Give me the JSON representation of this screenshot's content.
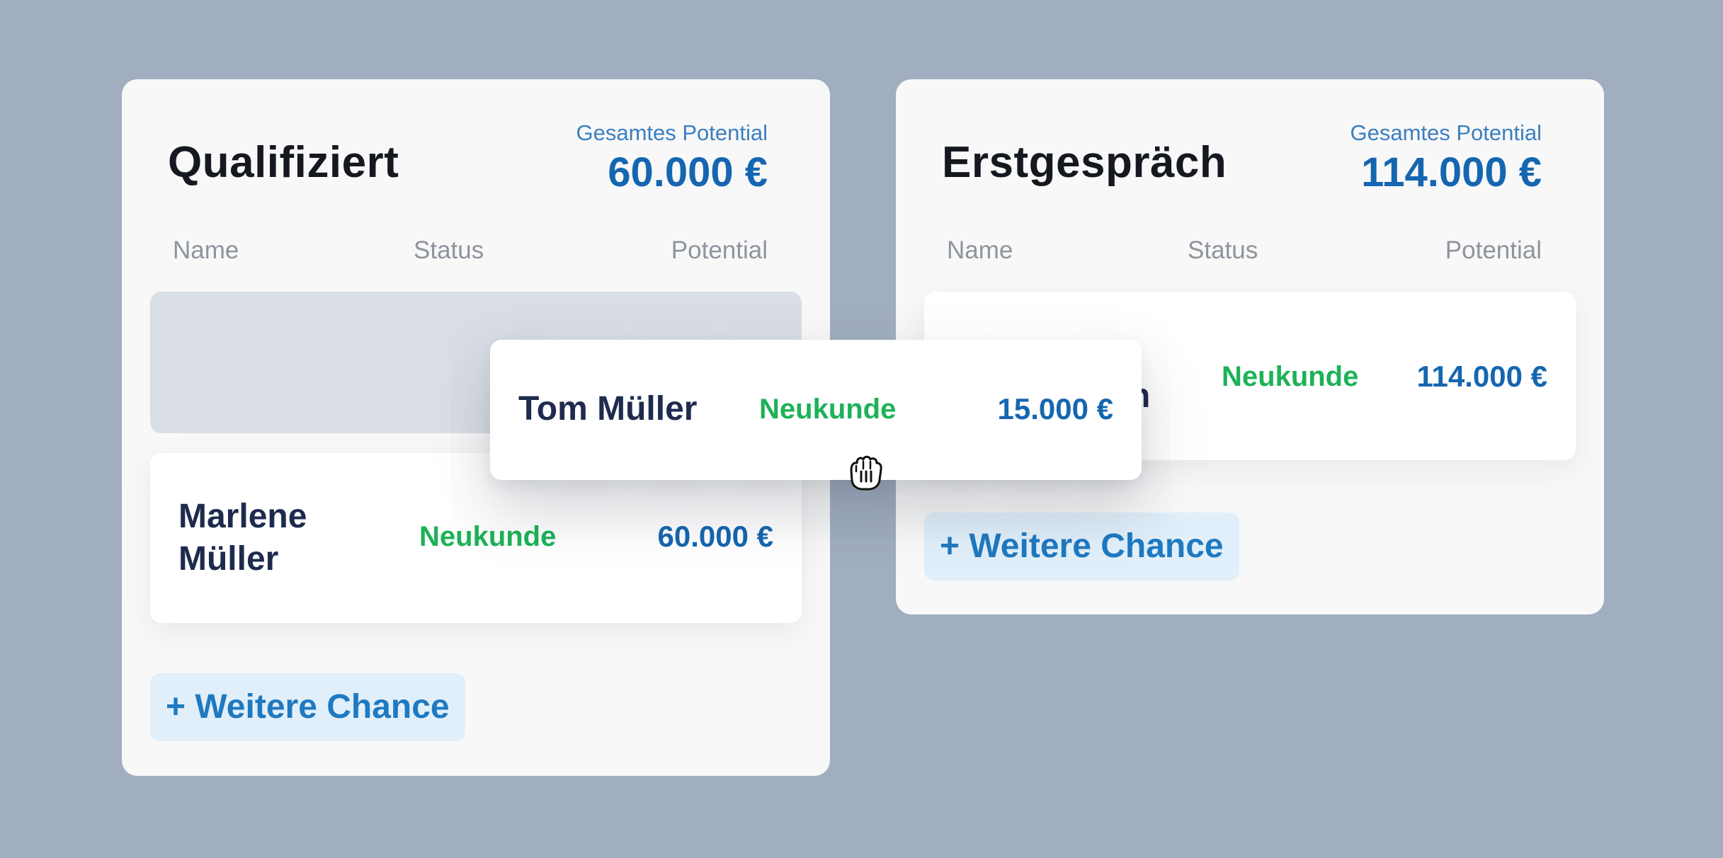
{
  "colors": {
    "background": "#a1aec0",
    "panel": "#f8f8f8",
    "placeholder": "#d9dee5",
    "accent_blue": "#1566b0",
    "status_green": "#1db257",
    "button_bg": "#e0effa"
  },
  "columns": [
    {
      "title": "Qualifiziert",
      "potential_label": "Gesamtes Potential",
      "potential_value": "60.000 €",
      "headers": {
        "name": "Name",
        "status": "Status",
        "potential": "Potential"
      },
      "cards": [
        {
          "name": "Marlene Müller",
          "status": "Neukunde",
          "potential": "60.000 €"
        }
      ],
      "add_button": "+ Weitere Chance"
    },
    {
      "title": "Erstgespräch",
      "potential_label": "Gesamtes Potential",
      "potential_value": "114.000 €",
      "headers": {
        "name": "Name",
        "status": "Status",
        "potential": "Potential"
      },
      "cards": [
        {
          "name_visible_fragment": "n",
          "status": "Neukunde",
          "potential": "114.000 €"
        }
      ],
      "add_button": "+ Weitere Chance"
    }
  ],
  "dragging_card": {
    "name": "Tom Müller",
    "status": "Neukunde",
    "potential": "15.000 €"
  },
  "cursor": {
    "icon": "grab-hand-icon"
  }
}
